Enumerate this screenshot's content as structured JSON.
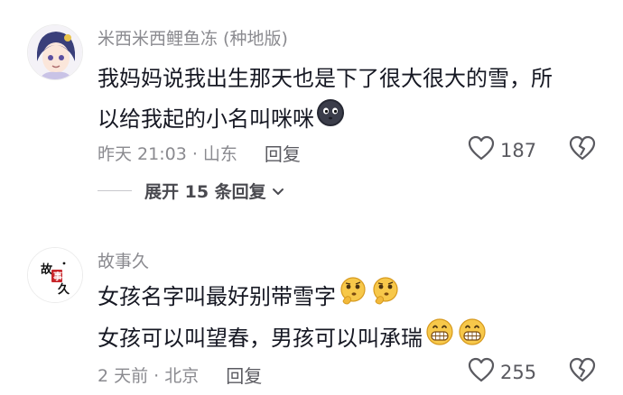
{
  "comments": [
    {
      "username": "米西米西鲤鱼冻 (种地版)",
      "lines": [
        "我妈妈说我出生那天也是下了很大很大的雪，所",
        "以给我起的小名叫咪咪"
      ],
      "line_emojis": [
        [],
        [
          "dark-blob-emoji"
        ]
      ],
      "time_location": "昨天 21:03 · 山东",
      "reply_label": "回复",
      "likes": "187",
      "avatar": "anime-character-avatar",
      "expand_label": "展开 15 条回复"
    },
    {
      "username": "故事久",
      "lines": [
        "女孩名字叫最好别带雪字",
        "女孩可以叫望春，男孩可以叫承瑞"
      ],
      "line_emojis": [
        [
          "thinking-emoji",
          "thinking-emoji"
        ],
        [
          "grinning-emoji",
          "grinning-emoji"
        ]
      ],
      "time_location": "2 天前 · 北京",
      "reply_label": "回复",
      "likes": "255",
      "avatar": "calligraphy-seal-avatar",
      "avatar_text": "故事久"
    }
  ],
  "colors": {
    "text_primary": "#161823",
    "text_secondary": "#8a8a8f",
    "icon_gray": "#5a5a60"
  }
}
